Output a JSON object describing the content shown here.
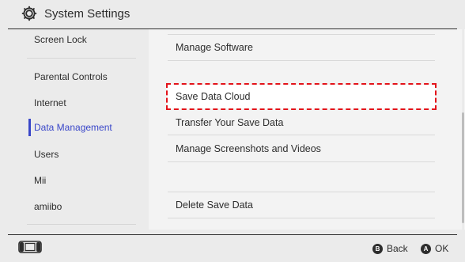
{
  "header": {
    "title": "System Settings",
    "icon": "gear-icon"
  },
  "sidebar": {
    "items": [
      {
        "label": "Screen Lock"
      },
      {
        "label": "Parental Controls"
      },
      {
        "label": "Internet"
      },
      {
        "label": "Data Management",
        "active": true
      },
      {
        "label": "Users"
      },
      {
        "label": "Mii"
      },
      {
        "label": "amiibo"
      }
    ]
  },
  "main": {
    "items": [
      {
        "label": "Manage Software"
      },
      {
        "label": "Save Data Cloud",
        "highlighted": true
      },
      {
        "label": "Transfer Your Save Data"
      },
      {
        "label": "Manage Screenshots and Videos"
      },
      {
        "label": "Delete Save Data"
      }
    ]
  },
  "footer": {
    "console_icon": "console-icon",
    "back": {
      "button": "B",
      "label": "Back"
    },
    "ok": {
      "button": "A",
      "label": "OK"
    }
  },
  "colors": {
    "accent": "#3a47c9",
    "highlight_outline": "#e3131a",
    "text": "#2d2d2d"
  }
}
